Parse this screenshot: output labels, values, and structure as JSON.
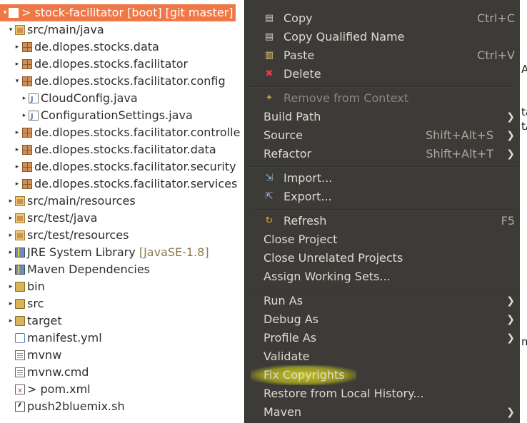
{
  "tree": {
    "items": [
      {
        "label": "> stock-facilitator [boot] [git master]",
        "icon": "spring-boot-project-icon",
        "arrow": "▾"
      },
      {
        "label": "src/main/java",
        "icon": "source-folder-icon",
        "arrow": "▾"
      },
      {
        "label": "de.dlopes.stocks.data",
        "icon": "package-icon",
        "arrow": "▸"
      },
      {
        "label": "de.dlopes.stocks.facilitator",
        "icon": "package-icon",
        "arrow": "▸"
      },
      {
        "label": "de.dlopes.stocks.facilitator.config",
        "icon": "package-icon",
        "arrow": "▾"
      },
      {
        "label": "CloudConfig.java",
        "icon": "java-file-icon",
        "arrow": "▸"
      },
      {
        "label": "ConfigurationSettings.java",
        "icon": "java-file-icon",
        "arrow": "▸"
      },
      {
        "label": "de.dlopes.stocks.facilitator.controlle",
        "icon": "package-icon",
        "arrow": "▸"
      },
      {
        "label": "de.dlopes.stocks.facilitator.data",
        "icon": "package-icon",
        "arrow": "▸"
      },
      {
        "label": "de.dlopes.stocks.facilitator.security",
        "icon": "package-icon",
        "arrow": "▸"
      },
      {
        "label": "de.dlopes.stocks.facilitator.services",
        "icon": "package-icon",
        "arrow": "▸"
      },
      {
        "label": "src/main/resources",
        "icon": "source-folder-icon",
        "arrow": "▸"
      },
      {
        "label": "src/test/java",
        "icon": "source-folder-icon",
        "arrow": "▸"
      },
      {
        "label": "src/test/resources",
        "icon": "source-folder-icon",
        "arrow": "▸"
      },
      {
        "label": "JRE System Library",
        "decoration": "[JavaSE-1.8]",
        "icon": "library-icon",
        "arrow": "▸"
      },
      {
        "label": "Maven Dependencies",
        "icon": "library-icon",
        "arrow": "▸"
      },
      {
        "label": "bin",
        "icon": "folder-icon",
        "arrow": "▸"
      },
      {
        "label": "src",
        "icon": "folder-icon",
        "arrow": "▸"
      },
      {
        "label": "target",
        "icon": "folder-icon",
        "arrow": "▸"
      },
      {
        "label": "manifest.yml",
        "icon": "yml-file-icon",
        "arrow": ""
      },
      {
        "label": "mvnw",
        "icon": "text-file-icon",
        "arrow": ""
      },
      {
        "label": "mvnw.cmd",
        "icon": "text-file-icon",
        "arrow": ""
      },
      {
        "label": "> pom.xml",
        "icon": "xml-file-icon",
        "arrow": ""
      },
      {
        "label": "push2bluemix.sh",
        "icon": "script-file-icon",
        "arrow": ""
      }
    ]
  },
  "menu": {
    "items": [
      {
        "label": "Copy",
        "accel": "Ctrl+C",
        "icon": "copy-icon"
      },
      {
        "label": "Copy Qualified Name",
        "accel": "",
        "icon": "copy-icon"
      },
      {
        "label": "Paste",
        "accel": "Ctrl+V",
        "icon": "paste-icon"
      },
      {
        "label": "Delete",
        "accel": "",
        "icon": "delete-icon"
      },
      {
        "label": "Remove from Context",
        "accel": "",
        "icon": "remove-context-icon"
      },
      {
        "label": "Build Path",
        "accel": "",
        "submenu": true
      },
      {
        "label": "Source",
        "accel": "Shift+Alt+S",
        "submenu": true
      },
      {
        "label": "Refactor",
        "accel": "Shift+Alt+T",
        "submenu": true
      },
      {
        "label": "Import...",
        "accel": "",
        "icon": "import-icon"
      },
      {
        "label": "Export...",
        "accel": "",
        "icon": "export-icon"
      },
      {
        "label": "Refresh",
        "accel": "F5",
        "icon": "refresh-icon"
      },
      {
        "label": "Close Project",
        "accel": ""
      },
      {
        "label": "Close Unrelated Projects",
        "accel": ""
      },
      {
        "label": "Assign Working Sets...",
        "accel": ""
      },
      {
        "label": "Run As",
        "accel": "",
        "submenu": true
      },
      {
        "label": "Debug As",
        "accel": "",
        "submenu": true
      },
      {
        "label": "Profile As",
        "accel": "",
        "submenu": true
      },
      {
        "label": "Validate",
        "accel": ""
      },
      {
        "label": "Fix Copyrights",
        "accel": ""
      },
      {
        "label": "Restore from Local History...",
        "accel": ""
      },
      {
        "label": "Maven",
        "accel": "",
        "submenu": true
      }
    ],
    "icons": {
      "delete_color": "#e04040",
      "refresh_color": "#f0a030"
    }
  },
  "colors": {
    "selection": "#f07746",
    "menu_bg": "#3c3b37",
    "menu_text": "#dfdbd2",
    "highlight": "#e6e61e"
  },
  "edge_fragments": [
    "A",
    "ta",
    "tA",
    "m"
  ]
}
